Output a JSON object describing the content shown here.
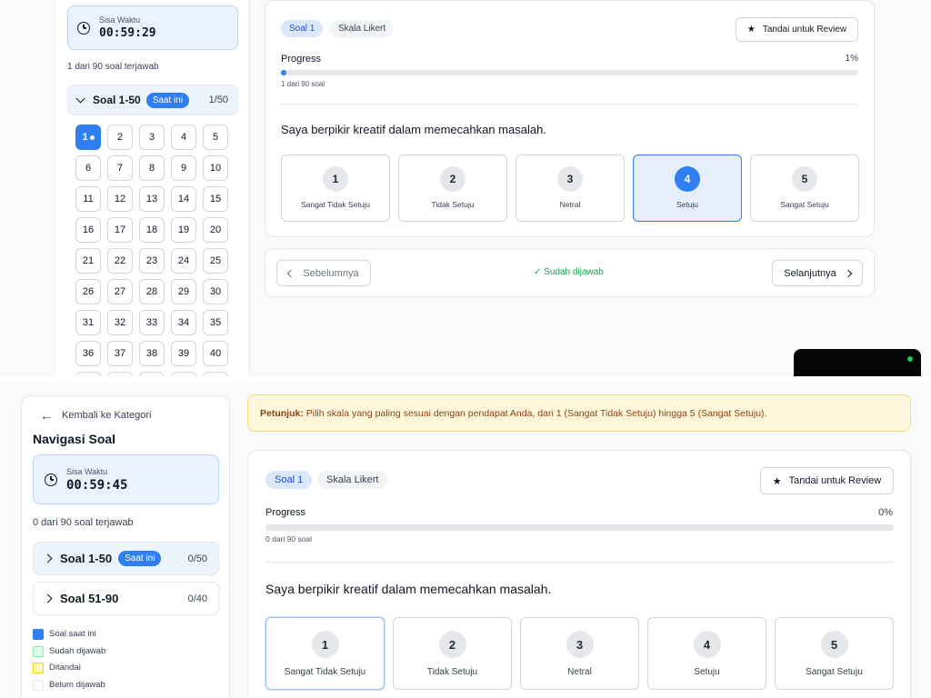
{
  "timer": {
    "label": "Sisa Waktu"
  },
  "screen1": {
    "time_value": "00:59:29",
    "answered_summary": "1 dari 90 soal terjawab",
    "section": {
      "title": "Soal 1-50",
      "badge": "Saat ini",
      "count": "1/50"
    },
    "numbers": [
      "1",
      "2",
      "3",
      "4",
      "5",
      "6",
      "7",
      "8",
      "9",
      "10",
      "11",
      "12",
      "13",
      "14",
      "15",
      "16",
      "17",
      "18",
      "19",
      "20",
      "21",
      "22",
      "23",
      "24",
      "25",
      "26",
      "27",
      "28",
      "29",
      "30",
      "31",
      "32",
      "33",
      "34",
      "35",
      "36",
      "37",
      "38",
      "39",
      "40"
    ],
    "active_number": "1",
    "chips": [
      "Soal 1",
      "Skala Likert"
    ],
    "review_label": "Tandai untuk Review",
    "progress": {
      "label": "Progress",
      "percent_text": "1%",
      "value": 0.01,
      "subtext": "1 dari 90 soal"
    },
    "question": "Saya berpikir kreatif dalam memecahkan masalah.",
    "options": [
      {
        "num": "1",
        "label": "Sangat Tidak Setuju"
      },
      {
        "num": "2",
        "label": "Tidak Setuju"
      },
      {
        "num": "3",
        "label": "Netral"
      },
      {
        "num": "4",
        "label": "Setuju"
      },
      {
        "num": "5",
        "label": "Sangat Setuju"
      }
    ],
    "selected_option": "4",
    "prev_label": "Sebelumnya",
    "answered_status": "Sudah dijawab",
    "next_label": "Selanjutnya"
  },
  "screen2": {
    "back_label": "Kembali ke Kategori",
    "nav_title": "Navigasi Soal",
    "time_value": "00:59:45",
    "answered_summary": "0 dari 90 soal terjawab",
    "sections": [
      {
        "title": "Soal 1-50",
        "badge": "Saat ini",
        "count": "0/50"
      },
      {
        "title": "Soal 51-90",
        "count": "0/40"
      }
    ],
    "legend": [
      {
        "label": "Soal saat ini",
        "color": "#2f7ff0"
      },
      {
        "label": "Sudah dijawab",
        "color": "#dcfce7"
      },
      {
        "label": "Ditandai",
        "color": "#fef9c3"
      },
      {
        "label": "Belum dijawab",
        "color": "#ffffff"
      }
    ],
    "instruction": {
      "bold": "Petunjuk:",
      "text": " Pilih skala yang paling sesuai dengan pendapat Anda, dari 1 (Sangat Tidak Setuju) hingga 5 (Sangat Setuju)."
    },
    "chips": [
      "Soal 1",
      "Skala Likert"
    ],
    "review_label": "Tandai untuk Review",
    "progress": {
      "label": "Progress",
      "percent_text": "0%",
      "value": 0,
      "subtext": "0 dari 90 soal"
    },
    "question": "Saya berpikir kreatif dalam memecahkan masalah.",
    "options": [
      {
        "num": "1",
        "label": "Sangat Tidak Setuju"
      },
      {
        "num": "2",
        "label": "Tidak Setuju"
      },
      {
        "num": "3",
        "label": "Netral"
      },
      {
        "num": "4",
        "label": "Setuju"
      },
      {
        "num": "5",
        "label": "Sangat Setuju"
      }
    ]
  },
  "colors": {
    "accent": "#2f7ff0",
    "success": "#16a34a",
    "warning_bg": "#fef7db",
    "warning_text": "#92400e"
  }
}
